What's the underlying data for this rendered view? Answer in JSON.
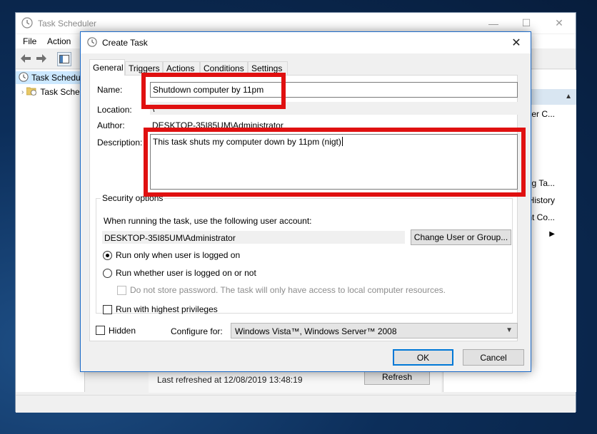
{
  "main_window": {
    "title": "Task Scheduler",
    "controls": {
      "minimize": "—",
      "maximize": "☐",
      "close": "✕"
    },
    "menu": [
      "File",
      "Action"
    ],
    "tree": [
      {
        "label": "Task Schedul",
        "selected": true
      },
      {
        "label": "Task Sche",
        "selected": false
      }
    ],
    "center": {
      "last_refreshed": "Last refreshed at 12/08/2019 13:48:19",
      "refresh_label": "Refresh"
    },
    "actions_pane": {
      "items": [
        "ner C...",
        "ing Ta...",
        "History",
        "nt Co..."
      ]
    }
  },
  "dialog": {
    "title": "Create Task",
    "close_label": "✕",
    "tabs": [
      "General",
      "Triggers",
      "Actions",
      "Conditions",
      "Settings"
    ],
    "active_tab": "General",
    "general": {
      "name_label": "Name:",
      "name_value": "Shutdown computer by 11pm",
      "location_label": "Location:",
      "location_value": "\\",
      "author_label": "Author:",
      "author_value": "DESKTOP-35I85UM\\Administrator",
      "description_label": "Description:",
      "description_value": "This task shuts my computer down by 11pm (nigt)",
      "security": {
        "title": "Security options",
        "account_prompt": "When running the task, use the following user account:",
        "account_value": "DESKTOP-35I85UM\\Administrator",
        "change_user_label": "Change User or Group...",
        "radio_logged_on": "Run only when user is logged on",
        "radio_logged_on_checked": true,
        "radio_whether": "Run whether user is logged on or not",
        "radio_whether_checked": false,
        "no_store_password": "Do not store password.  The task will only have access to local computer resources.",
        "highest_privileges": "Run with highest privileges"
      },
      "hidden_label": "Hidden",
      "configure_label": "Configure for:",
      "configure_value": "Windows Vista™, Windows Server™ 2008"
    },
    "ok_label": "OK",
    "cancel_label": "Cancel"
  },
  "colors": {
    "highlight_box": "#e01010",
    "selection": "#cce8ff",
    "default_button_border": "#0078d7"
  }
}
